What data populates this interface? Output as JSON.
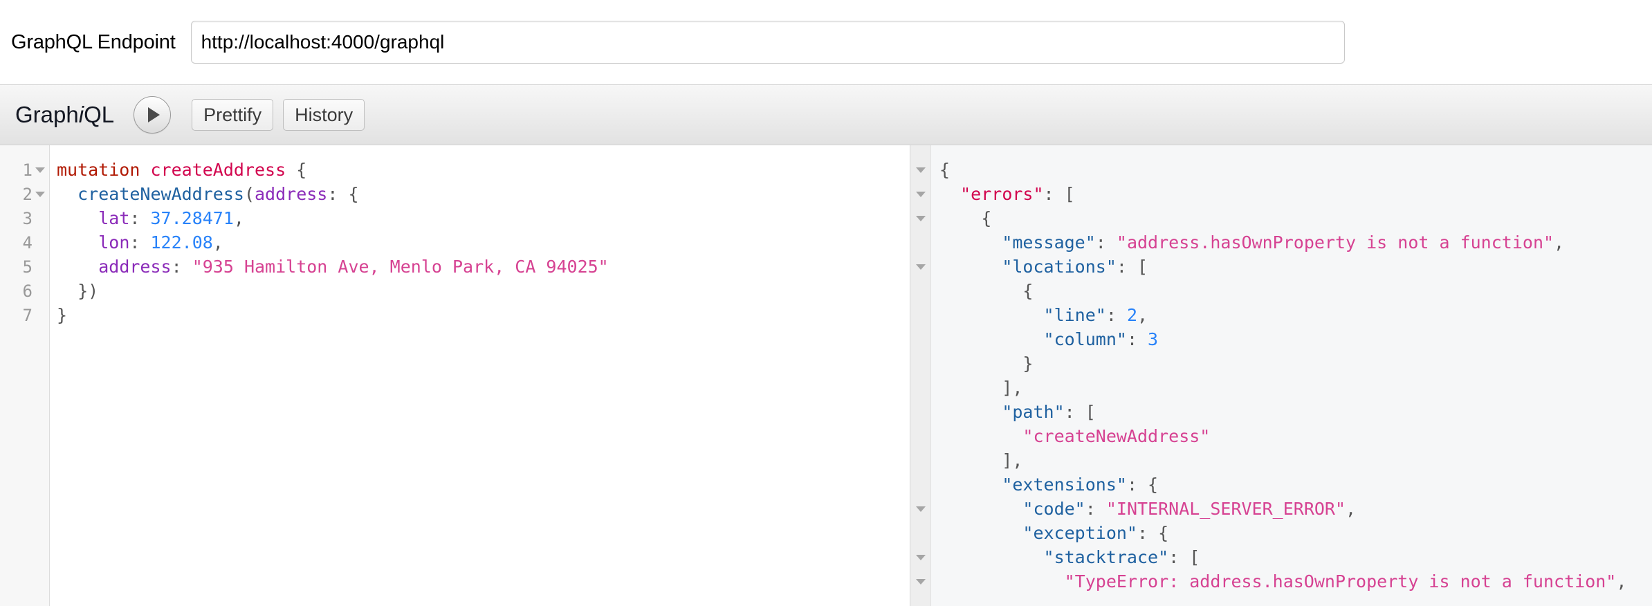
{
  "endpoint": {
    "label": "GraphQL Endpoint",
    "value": "http://localhost:4000/graphql",
    "placeholder": "http://localhost:4000/graphql"
  },
  "toolbar": {
    "logo_prefix": "Graph",
    "logo_italic": "i",
    "logo_suffix": "QL",
    "execute_icon": "play-icon",
    "prettify_label": "Prettify",
    "history_label": "History"
  },
  "query_editor": {
    "line_numbers": [
      "1",
      "2",
      "3",
      "4",
      "5",
      "6",
      "7"
    ],
    "fold_markers": [
      true,
      true,
      false,
      false,
      false,
      false,
      false
    ],
    "lines": [
      [
        {
          "t": "mutation",
          "c": "t-keyword"
        },
        {
          "t": " ",
          "c": "t-punct"
        },
        {
          "t": "createAddress",
          "c": "t-def"
        },
        {
          "t": " {",
          "c": "t-punct"
        }
      ],
      [
        {
          "t": "  ",
          "c": "t-punct"
        },
        {
          "t": "createNewAddress",
          "c": "t-atom"
        },
        {
          "t": "(",
          "c": "t-punct"
        },
        {
          "t": "address",
          "c": "t-attr"
        },
        {
          "t": ": {",
          "c": "t-punct"
        }
      ],
      [
        {
          "t": "    ",
          "c": "t-punct"
        },
        {
          "t": "lat",
          "c": "t-attr"
        },
        {
          "t": ": ",
          "c": "t-punct"
        },
        {
          "t": "37.28471",
          "c": "t-number"
        },
        {
          "t": ",",
          "c": "t-punct"
        }
      ],
      [
        {
          "t": "    ",
          "c": "t-punct"
        },
        {
          "t": "lon",
          "c": "t-attr"
        },
        {
          "t": ": ",
          "c": "t-punct"
        },
        {
          "t": "122.08",
          "c": "t-number"
        },
        {
          "t": ",",
          "c": "t-punct"
        }
      ],
      [
        {
          "t": "    ",
          "c": "t-punct"
        },
        {
          "t": "address",
          "c": "t-attr"
        },
        {
          "t": ": ",
          "c": "t-punct"
        },
        {
          "t": "\"935 Hamilton Ave, Menlo Park, CA 94025\"",
          "c": "t-string"
        }
      ],
      [
        {
          "t": "  })",
          "c": "t-punct"
        }
      ],
      [
        {
          "t": "}",
          "c": "t-punct"
        }
      ]
    ]
  },
  "result_panel": {
    "fold_markers": [
      true,
      true,
      true,
      false,
      true,
      false,
      false,
      false,
      false,
      false,
      false,
      false,
      false,
      false,
      true,
      false,
      true,
      true,
      false
    ],
    "lines": [
      [
        {
          "t": "{",
          "c": "t-punct"
        }
      ],
      [
        {
          "t": "  ",
          "c": "t-punct"
        },
        {
          "t": "\"errors\"",
          "c": "t-errkey"
        },
        {
          "t": ": [",
          "c": "t-punct"
        }
      ],
      [
        {
          "t": "    {",
          "c": "t-punct"
        }
      ],
      [
        {
          "t": "      ",
          "c": "t-punct"
        },
        {
          "t": "\"message\"",
          "c": "t-key"
        },
        {
          "t": ": ",
          "c": "t-punct"
        },
        {
          "t": "\"address.hasOwnProperty is not a function\"",
          "c": "t-string"
        },
        {
          "t": ",",
          "c": "t-punct"
        }
      ],
      [
        {
          "t": "      ",
          "c": "t-punct"
        },
        {
          "t": "\"locations\"",
          "c": "t-key"
        },
        {
          "t": ": [",
          "c": "t-punct"
        }
      ],
      [
        {
          "t": "        {",
          "c": "t-punct"
        }
      ],
      [
        {
          "t": "          ",
          "c": "t-punct"
        },
        {
          "t": "\"line\"",
          "c": "t-key"
        },
        {
          "t": ": ",
          "c": "t-punct"
        },
        {
          "t": "2",
          "c": "t-number"
        },
        {
          "t": ",",
          "c": "t-punct"
        }
      ],
      [
        {
          "t": "          ",
          "c": "t-punct"
        },
        {
          "t": "\"column\"",
          "c": "t-key"
        },
        {
          "t": ": ",
          "c": "t-punct"
        },
        {
          "t": "3",
          "c": "t-number"
        }
      ],
      [
        {
          "t": "        }",
          "c": "t-punct"
        }
      ],
      [
        {
          "t": "      ],",
          "c": "t-punct"
        }
      ],
      [
        {
          "t": "      ",
          "c": "t-punct"
        },
        {
          "t": "\"path\"",
          "c": "t-key"
        },
        {
          "t": ": [",
          "c": "t-punct"
        }
      ],
      [
        {
          "t": "        ",
          "c": "t-punct"
        },
        {
          "t": "\"createNewAddress\"",
          "c": "t-string"
        }
      ],
      [
        {
          "t": "      ],",
          "c": "t-punct"
        }
      ],
      [
        {
          "t": "      ",
          "c": "t-punct"
        },
        {
          "t": "\"extensions\"",
          "c": "t-key"
        },
        {
          "t": ": {",
          "c": "t-punct"
        }
      ],
      [
        {
          "t": "        ",
          "c": "t-punct"
        },
        {
          "t": "\"code\"",
          "c": "t-key"
        },
        {
          "t": ": ",
          "c": "t-punct"
        },
        {
          "t": "\"INTERNAL_SERVER_ERROR\"",
          "c": "t-string"
        },
        {
          "t": ",",
          "c": "t-punct"
        }
      ],
      [
        {
          "t": "        ",
          "c": "t-punct"
        },
        {
          "t": "\"exception\"",
          "c": "t-key"
        },
        {
          "t": ": {",
          "c": "t-punct"
        }
      ],
      [
        {
          "t": "          ",
          "c": "t-punct"
        },
        {
          "t": "\"stacktrace\"",
          "c": "t-key"
        },
        {
          "t": ": [",
          "c": "t-punct"
        }
      ],
      [
        {
          "t": "            ",
          "c": "t-punct"
        },
        {
          "t": "\"TypeError: address.hasOwnProperty is not a function\"",
          "c": "t-string"
        },
        {
          "t": ",",
          "c": "t-punct"
        }
      ]
    ]
  },
  "colors": {
    "keyword": "#b11a04",
    "definition": "#d2054e",
    "attribute": "#1f61a0",
    "argument": "#8b2bb9",
    "number": "#2882f9",
    "string": "#d64292",
    "result_background": "#f6f7f8",
    "toolbar_background": "#eeeeee"
  }
}
